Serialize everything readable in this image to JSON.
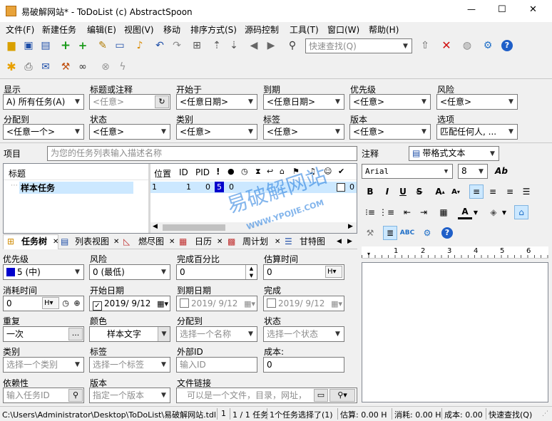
{
  "window": {
    "title": "易破解网站* - ToDoList (c) AbstractSpoon",
    "min": "—",
    "max": "☐",
    "close": "✕"
  },
  "menu": [
    "文件(F)",
    "新建任务",
    "编辑(E)",
    "视图(V)",
    "移动",
    "排序方式(S)",
    "源码控制",
    "工具(T)",
    "窗口(W)",
    "帮助(H)"
  ],
  "toolbar": {
    "search_placeholder": "快速查找(Q)"
  },
  "filters": {
    "row1": [
      {
        "label": "显示",
        "value": "A)  所有任务(A)"
      },
      {
        "label": "标题或注释",
        "value": "<任意>"
      },
      {
        "label": "开始于",
        "value": "<任意日期>"
      },
      {
        "label": "到期",
        "value": "<任意日期>"
      },
      {
        "label": "优先级",
        "value": "<任意>"
      },
      {
        "label": "风险",
        "value": "<任意>"
      }
    ],
    "row2": [
      {
        "label": "分配到",
        "value": "<任意一个>"
      },
      {
        "label": "状态",
        "value": "<任意>"
      },
      {
        "label": "类别",
        "value": "<任意>"
      },
      {
        "label": "标签",
        "value": "<任意>"
      },
      {
        "label": "版本",
        "value": "<任意>"
      },
      {
        "label": "选项",
        "value": "匹配任何人, ..."
      }
    ]
  },
  "project": {
    "label": "项目",
    "placeholder": "为您的任务列表输入描述名称"
  },
  "tasklist": {
    "col_title": "标题",
    "cols": [
      "位置",
      "ID",
      "PID"
    ],
    "rows": [
      {
        "title": "样本任务",
        "pos": "1",
        "id": "1",
        "pid": "0",
        "pri": "5",
        "extra": "0"
      }
    ]
  },
  "tabs": [
    "任务树",
    "列表视图",
    "燃尽图",
    "日历",
    "周计划",
    "甘特图"
  ],
  "props": {
    "priority": {
      "label": "优先级",
      "value": "5 (中)"
    },
    "risk": {
      "label": "风险",
      "value": "0 (最低)"
    },
    "percent": {
      "label": "完成百分比",
      "value": "0"
    },
    "estimate": {
      "label": "估算时间",
      "value": "0",
      "unit": "H"
    },
    "spent": {
      "label": "消耗时间",
      "value": "0",
      "unit": "H"
    },
    "start": {
      "label": "开始日期",
      "value": "2019/  9/12"
    },
    "due": {
      "label": "到期日期",
      "value": "2019/  9/12"
    },
    "done": {
      "label": "完成",
      "value": "2019/  9/12"
    },
    "recur": {
      "label": "重复",
      "value": "一次"
    },
    "color": {
      "label": "颜色",
      "value": "样本文字"
    },
    "assign": {
      "label": "分配到",
      "placeholder": "选择一个名称"
    },
    "status": {
      "label": "状态",
      "placeholder": "选择一个状态"
    },
    "category": {
      "label": "类别",
      "placeholder": "选择一个类别"
    },
    "tags": {
      "label": "标签",
      "placeholder": "选择一个标签"
    },
    "extid": {
      "label": "外部ID",
      "placeholder": "输入ID"
    },
    "cost": {
      "label": "成本:",
      "value": "0"
    },
    "depends": {
      "label": "依赖性",
      "placeholder": "输入任务ID"
    },
    "version": {
      "label": "版本",
      "placeholder": "指定一个版本"
    },
    "filelink": {
      "label": "文件链接",
      "placeholder": "可以是一个文件，目录，网址，"
    }
  },
  "notes": {
    "label": "注释",
    "format": "带格式文本",
    "font": "Arial",
    "size": "8",
    "ruler": [
      "1",
      "2",
      "3",
      "4",
      "5",
      "6"
    ]
  },
  "watermark": {
    "line1": "易破解网站",
    "line2": "WWW.YPOJIE.COM"
  },
  "statusbar": [
    "C:\\Users\\Administrator\\Desktop\\ToDoList\\易破解网站.tdl",
    "1",
    "1 / 1 任务",
    "1个任务选择了(1)",
    "估算: 0.00 H",
    "消耗: 0.00 H",
    "成本: 0.00",
    "快速查找(Q)"
  ],
  "colors": {
    "selected_row": "#cce8ff",
    "accent": "#0078d7",
    "pri_bg": "#0000cc"
  }
}
